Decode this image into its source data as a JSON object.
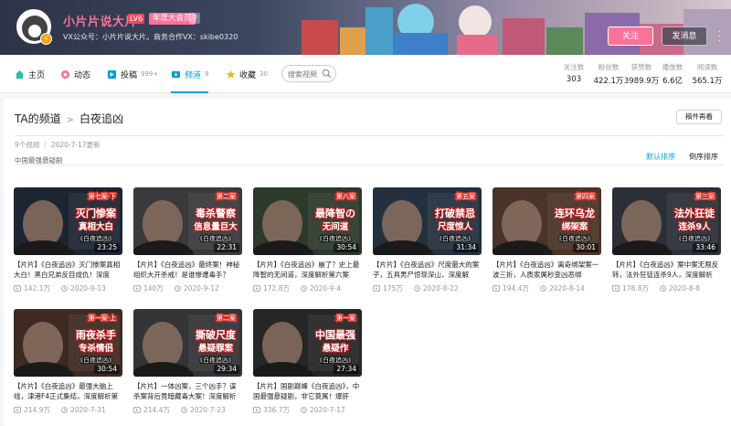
{
  "header": {
    "username": "小片片说大片",
    "level": "LV6",
    "vip_badge": "年度大会员",
    "sex_badge": "♀",
    "avatar_badge": "⚡",
    "signature": "VX公众号：小片片说大片。商务合作VX：skibe0320",
    "follow_label": "关注",
    "message_label": "发消息"
  },
  "nav": {
    "items": [
      {
        "label": "主页",
        "count": ""
      },
      {
        "label": "动态",
        "count": ""
      },
      {
        "label": "投稿",
        "count": "999+"
      },
      {
        "label": "频道",
        "count": "9"
      },
      {
        "label": "收藏",
        "count": "30"
      }
    ],
    "search_placeholder": "搜索视频"
  },
  "stats": [
    {
      "label": "关注数",
      "value": "303"
    },
    {
      "label": "粉丝数",
      "value": "422.1万"
    },
    {
      "label": "获赞数",
      "value": "3989.9万"
    },
    {
      "label": "播放数",
      "value": "6.6亿"
    },
    {
      "label": "阅读数",
      "value": "565.1万"
    }
  ],
  "channel": {
    "breadcrumb_root": "TA的频道",
    "breadcrumb_current": "白夜追凶",
    "manage_label": "稿件再看",
    "video_count": "9个视频",
    "updated": "2020-7-17更新",
    "description": "中国最强悬疑剧",
    "sort_default": "默认排序",
    "sort_reverse": "倒序排序"
  },
  "videos": [
    {
      "title": "【片片】《白夜追凶》灭门惨案真相大白！黑白兄弟反目成仇！深度",
      "duration": "23:25",
      "plays": "142.1万",
      "date": "2020-9-13",
      "thumb_text": "灭门惨案 真相大白",
      "case": "第七案·下",
      "subtitle": "《白夜追凶》",
      "color": "#1d2533",
      "accent": "#d9342b"
    },
    {
      "title": "【片片】《白夜追凶》最终案！神秘组织大开杀戒！是谁惨遭毒手？",
      "duration": "22:31",
      "plays": "140万",
      "date": "2020-9-12",
      "thumb_text": "毒杀警察 信息量巨大",
      "case": "第二案",
      "subtitle": "《白夜追凶》",
      "color": "#3a3a3c",
      "accent": "#d9342b"
    },
    {
      "title": "【片片】《白夜追凶》崩了？史上最降智的无间道，深度解析第六案",
      "duration": "30:54",
      "plays": "172.8万",
      "date": "2020-9-4",
      "thumb_text": "最降智の 无间道",
      "case": "第八案",
      "subtitle": "《白夜追凶》",
      "color": "#2c3a2c",
      "accent": "#d9342b"
    },
    {
      "title": "【片片】《白夜追凶》尺度最大的案子，五具男尸惊现深山，深度解",
      "duration": "31:34",
      "plays": "175万",
      "date": "2020-8-22",
      "thumb_text": "打破禁忌 尺度惊人",
      "case": "第五案",
      "subtitle": "《白夜追凶》",
      "color": "#24303e",
      "accent": "#d9342b"
    },
    {
      "title": "【片片】《白夜追凶》离奇绑架案一波三折，人质家属秒变凶恶绑",
      "duration": "30:01",
      "plays": "194.4万",
      "date": "2020-8-14",
      "thumb_text": "连环乌龙 绑架案",
      "case": "第四案",
      "subtitle": "《白夜追凶》",
      "color": "#4a3328",
      "accent": "#d9342b"
    },
    {
      "title": "【片片】《白夜追凶》案中案无限反转，法外狂徒连杀9人，深度解析",
      "duration": "33:46",
      "plays": "178.8万",
      "date": "2020-8-8",
      "thumb_text": "法外狂徒 连杀9人",
      "case": "第三案",
      "subtitle": "《白夜追凶》",
      "color": "#2b2f38",
      "accent": "#d9342b"
    },
    {
      "title": "【片片】《白夜追凶》最强大脑上线，津港F4正式集结，深度解析第",
      "duration": "30:54",
      "plays": "214.9万",
      "date": "2020-7-31",
      "thumb_text": "雨夜杀手 专杀情侣",
      "case": "第一案·上",
      "subtitle": "《白夜追凶》",
      "color": "#3d2a22",
      "accent": "#d9342b"
    },
    {
      "title": "【片片】一体凶案，三个凶手？谋杀案背后竟暗藏毒大案！深度解析",
      "duration": "29:34",
      "plays": "214.4万",
      "date": "2020-7-23",
      "thumb_text": "撕破尺度 悬疑罪案",
      "case": "第二案",
      "subtitle": "《白夜追凶》",
      "color": "#333338",
      "accent": "#d9342b"
    },
    {
      "title": "【片片】国剧巅峰《白夜追凶》，中国最强悬疑剧，非它莫属！爆肝",
      "duration": "27:34",
      "plays": "336.7万",
      "date": "2020-7-17",
      "thumb_text": "中国最强 悬疑作",
      "case": "第一案",
      "subtitle": "《白夜追凶》",
      "color": "#262626",
      "accent": "#d9342b"
    }
  ]
}
